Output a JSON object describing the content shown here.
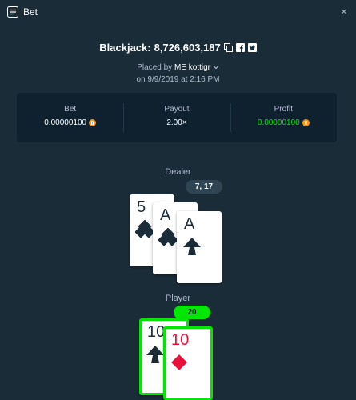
{
  "window": {
    "title": "Bet",
    "close_glyph": "×"
  },
  "bet": {
    "game": "Blackjack:",
    "bet_id": "8,726,603,187",
    "placed_by_prefix": "Placed by",
    "user": "ME kottigr",
    "date_line": "on 9/9/2019 at 2:16 PM"
  },
  "stats": {
    "bet": {
      "label": "Bet",
      "value": "0.00000100",
      "currency_icon": "bitcoin-coin-icon"
    },
    "payout": {
      "label": "Payout",
      "value": "2.00×"
    },
    "profit": {
      "label": "Profit",
      "value": "0.00000100",
      "currency_icon": "bitcoin-coin-icon"
    }
  },
  "dealer": {
    "label": "Dealer",
    "total": "7, 17",
    "cards": [
      {
        "rank": "5",
        "suit": "club",
        "color": "black"
      },
      {
        "rank": "A",
        "suit": "club",
        "color": "black"
      },
      {
        "rank": "A",
        "suit": "spade",
        "color": "black"
      }
    ]
  },
  "player": {
    "label": "Player",
    "total": "20",
    "cards": [
      {
        "rank": "10",
        "suit": "spade",
        "color": "black"
      },
      {
        "rank": "10",
        "suit": "diamond",
        "color": "red"
      }
    ]
  },
  "colors": {
    "background": "#1a2c38",
    "panel": "#0f212e",
    "win_green": "#00e701",
    "muted_text": "#b1bad3",
    "card_red": "#e9113c"
  }
}
